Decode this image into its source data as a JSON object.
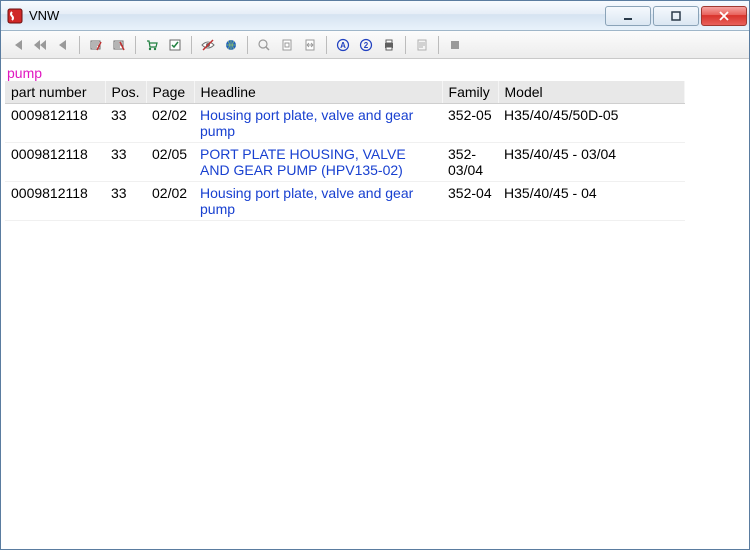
{
  "window": {
    "title": "VNW"
  },
  "search_term": "pump",
  "columns": {
    "part_number": "part number",
    "pos": "Pos.",
    "page": "Page",
    "headline": "Headline",
    "family": "Family",
    "model": "Model"
  },
  "rows": [
    {
      "part_number": "0009812118",
      "pos": "33",
      "page": "02/02",
      "headline": "Housing port plate, valve and gear pump",
      "family": "352-05",
      "model": "H35/40/45/50D-05"
    },
    {
      "part_number": "0009812118",
      "pos": "33",
      "page": "02/05",
      "headline": "PORT PLATE HOUSING, VALVE AND GEAR PUMP (HPV135-02)",
      "family": "352-03/04",
      "model": "H35/40/45 - 03/04"
    },
    {
      "part_number": "0009812118",
      "pos": "33",
      "page": "02/02",
      "headline": "Housing port plate, valve and gear pump",
      "family": "352-04",
      "model": "H35/40/45 - 04"
    }
  ]
}
